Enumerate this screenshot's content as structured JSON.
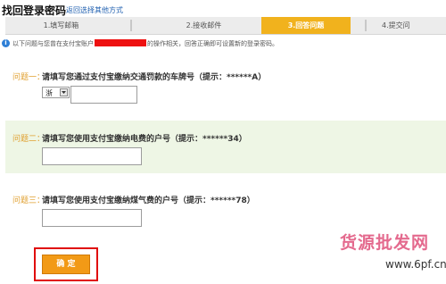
{
  "header": {
    "title": "找回登录密码",
    "alt_link": "返回选择其他方式"
  },
  "steps": [
    {
      "label": "1.填写邮箱"
    },
    {
      "label": "2.接收邮件"
    },
    {
      "label": "3.回答问题"
    },
    {
      "label": "4.提交问"
    }
  ],
  "info": {
    "text_before": "以下问题与您曾在支付宝账户",
    "text_after": "的操作相关，回答正确即可设置新的登录密码。"
  },
  "questions": [
    {
      "label": "问题一：",
      "text": "请填写您通过支付宝缴纳交通罚款的车牌号（提示：******A）",
      "select_value": "浙",
      "input_value": ""
    },
    {
      "label": "问题二：",
      "text": "请填写您使用支付宝缴纳电费的户号（提示：******34）",
      "input_value": ""
    },
    {
      "label": "问题三：",
      "text": "请填写您使用支付宝缴纳煤气费的户号（提示：******78）",
      "input_value": ""
    }
  ],
  "confirm_button": "确 定",
  "watermark": {
    "logo": "货源批发网",
    "url": "www.6pf.cn"
  },
  "colors": {
    "active_step": "#f1b21d",
    "confirm_button": "#f29a16",
    "highlight_border": "#e00b0b",
    "question_label": "#e0a030",
    "link": "#2060b0"
  }
}
